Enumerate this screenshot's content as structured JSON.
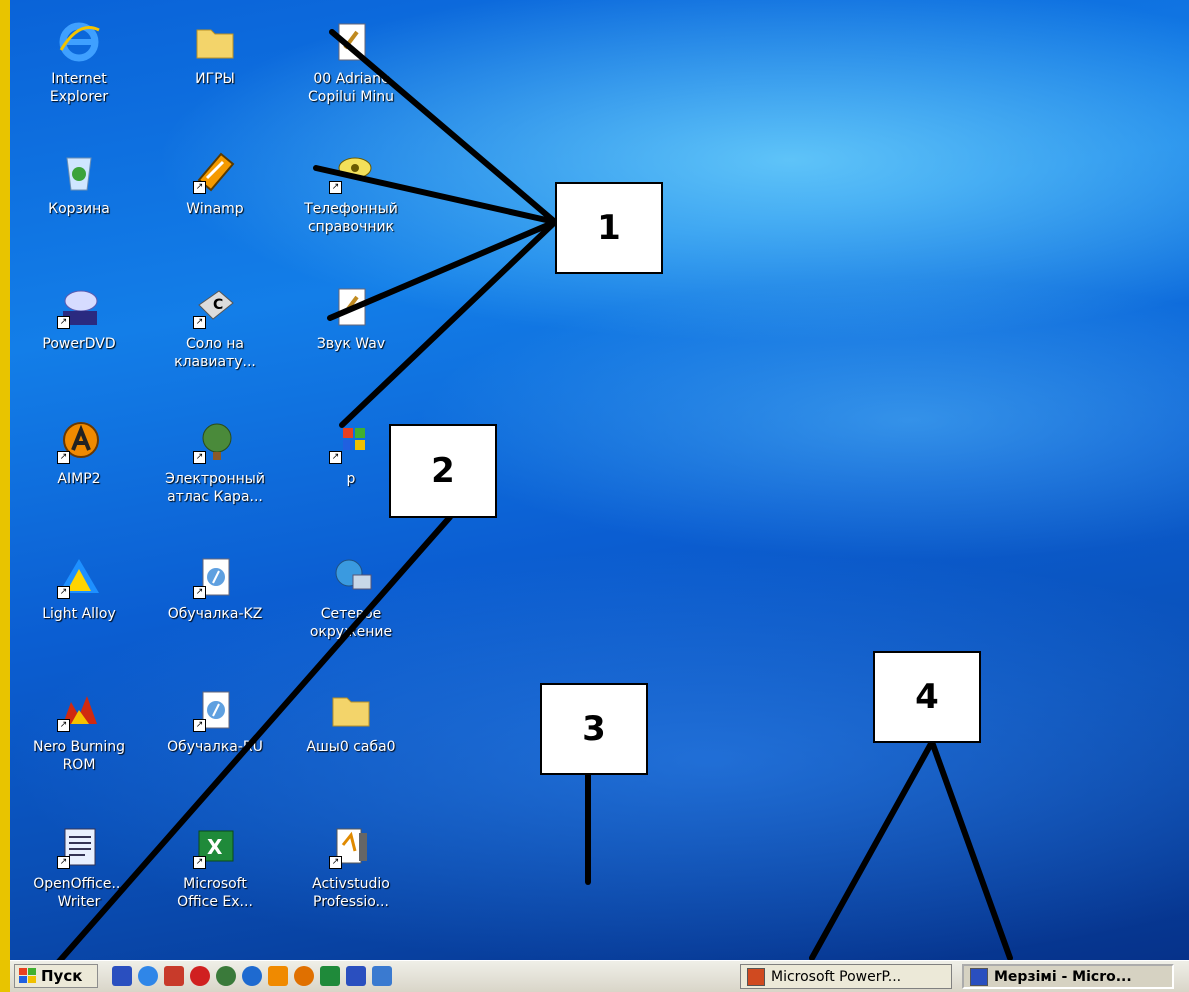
{
  "desktop": {
    "icons": [
      {
        "label": "Internet\nExplorer"
      },
      {
        "label": "ИГРЫ"
      },
      {
        "label": "00 Adrianc\nCopilui Minu"
      },
      {
        "label": "Корзина"
      },
      {
        "label": "Winamp"
      },
      {
        "label": "Телефонный\nсправочник"
      },
      {
        "label": "PowerDVD"
      },
      {
        "label": "Соло на\nклавиату..."
      },
      {
        "label": "Звук Wav"
      },
      {
        "label": "AIMP2"
      },
      {
        "label": "Электронный\nатлас Кара..."
      },
      {
        "label": "р"
      },
      {
        "label": "Light Alloy"
      },
      {
        "label": "Обучалка-KZ"
      },
      {
        "label": "Сетевое\nокружение"
      },
      {
        "label": "Nero Burning\nROM"
      },
      {
        "label": "Обучалка-RU"
      },
      {
        "label": "Ашы0 саба0"
      },
      {
        "label": "OpenOffice...\nWriter"
      },
      {
        "label": "Microsoft\nOffice Ex..."
      },
      {
        "label": "Activstudio\nProfessio..."
      }
    ]
  },
  "callouts": [
    "1",
    "2",
    "3",
    "4"
  ],
  "taskbar": {
    "start_label": "Пуск",
    "quick_launch": [
      "save-icon",
      "ie-icon",
      "outlook-icon",
      "media-icon",
      "globe-icon",
      "player-icon",
      "winamp-icon",
      "aimp-icon",
      "excel-icon",
      "word-icon",
      "refresh-icon"
    ],
    "tasks": [
      {
        "label": "Microsoft PowerP...",
        "icon": "powerpoint-icon",
        "active": false
      },
      {
        "label": "Мерзімі - Micro...",
        "icon": "word-icon",
        "active": true
      }
    ]
  },
  "colors": {
    "frame": "#e8c400",
    "desktop": "#0b63d4",
    "taskbar": "#ece9d8"
  }
}
